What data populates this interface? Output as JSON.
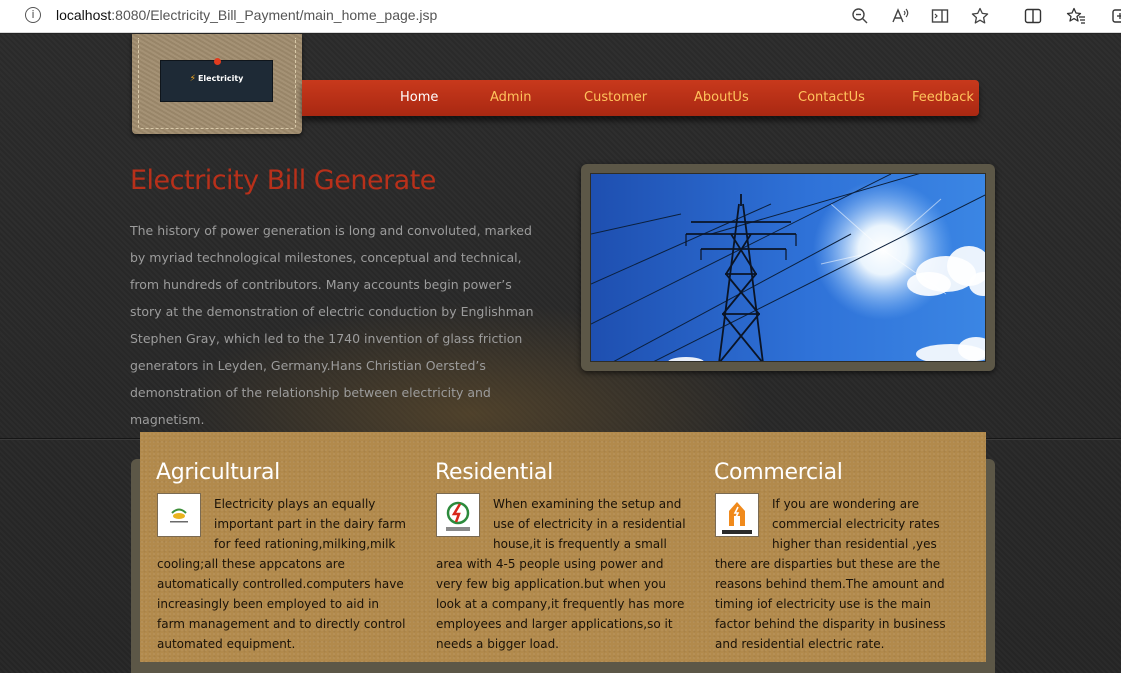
{
  "browser": {
    "url_host": "localhost",
    "url_path": ":8080/Electricity_Bill_Payment/main_home_page.jsp",
    "icons": [
      "info-icon",
      "zoom-out-icon",
      "read-aloud-icon",
      "app-available-icon",
      "favorite-star-icon",
      "split-screen-icon",
      "favorites-icon",
      "collections-icon"
    ]
  },
  "logo": {
    "text": "Electricity"
  },
  "nav": {
    "items": [
      {
        "label": "Home"
      },
      {
        "label": "Admin"
      },
      {
        "label": "Customer"
      },
      {
        "label": "AboutUs"
      },
      {
        "label": "ContactUs"
      },
      {
        "label": "Feedback"
      }
    ],
    "active": "Home"
  },
  "hero": {
    "title": "Electricity Bill Generate",
    "text": "The history of power generation is long and convoluted, marked by myriad technological milestones, conceptual and technical, from hundreds of contributors. Many accounts begin power’s story at the demonstration of electric conduction by Englishman Stephen Gray, which led to the 1740 invention of glass friction generators in Leyden, Germany.Hans Christian Oersted’s demonstration of the relationship between electricity and magnetism.",
    "image": "power-transmission-tower-photo"
  },
  "services": [
    {
      "title": "Agricultural",
      "icon": "agriculture-thumbnail",
      "text": "Electricity plays an equally important part in the dairy farm for feed rationing,milking,milk cooling;all these appcatons are automatically controlled.computers have increasingly been employed to aid in farm management and to directly control automated equipment."
    },
    {
      "title": "Residential",
      "icon": "residential-electric-thumbnail",
      "text": "When examining the setup and use of electricity in a residential house,it is frequently a small area with 4-5 people using power and very few big application.but when you look at a company,it frequently has more employees and larger applications,so it needs a bigger load."
    },
    {
      "title": "Commercial",
      "icon": "commercial-building-thumbnail",
      "text": "If you are wondering are commercial electricity rates higher than residential ,yes there are disparties but these are the reasons behind them.The amount and timing iof electricity use is the main factor behind the disparity in business and residential electric rate."
    }
  ],
  "colors": {
    "nav_red": "#b8301a",
    "nav_text": "#ffc35c",
    "title_red": "#b8301a",
    "panel_tan": "#b28a4c",
    "page_dark": "#262626"
  }
}
